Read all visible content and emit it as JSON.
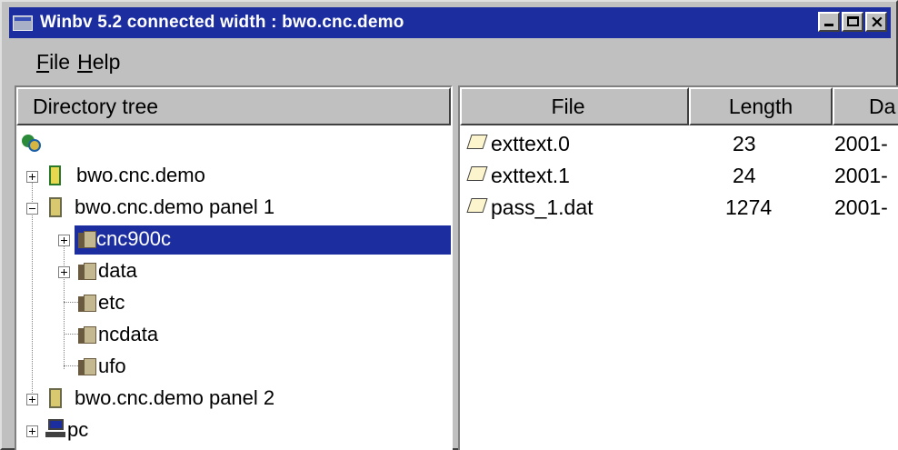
{
  "window": {
    "title": "Winbv 5.2 connected width : bwo.cnc.demo",
    "close_glyph": "×"
  },
  "menu": {
    "file_accel": "F",
    "file_rest": "ile",
    "help_accel": "H",
    "help_rest": "elp"
  },
  "tree": {
    "header": "Directory tree",
    "items": [
      {
        "label": "bwo.cnc.demo",
        "icon": "host-icon"
      },
      {
        "label": "bwo.cnc.demo panel 1",
        "icon": "panel-icon"
      },
      {
        "label": "cnc900c",
        "icon": "folder-icon",
        "selected": true
      },
      {
        "label": "data",
        "icon": "folder-icon"
      },
      {
        "label": "etc",
        "icon": "folder-icon"
      },
      {
        "label": "ncdata",
        "icon": "folder-icon"
      },
      {
        "label": "ufo",
        "icon": "folder-icon"
      },
      {
        "label": "bwo.cnc.demo panel 2",
        "icon": "panel-icon"
      },
      {
        "label": "pc",
        "icon": "pc-icon"
      }
    ]
  },
  "files": {
    "columns": [
      "File",
      "Length",
      "Da"
    ],
    "rows": [
      {
        "name": "exttext.0",
        "length": "23",
        "date": "2001-"
      },
      {
        "name": "exttext.1",
        "length": "24",
        "date": "2001-"
      },
      {
        "name": "pass_1.dat",
        "length": "1274",
        "date": "2001-"
      }
    ]
  },
  "colors": {
    "titlebar": "#1c2da0",
    "selection": "#1c2da0",
    "chrome": "#c0c0c0"
  }
}
